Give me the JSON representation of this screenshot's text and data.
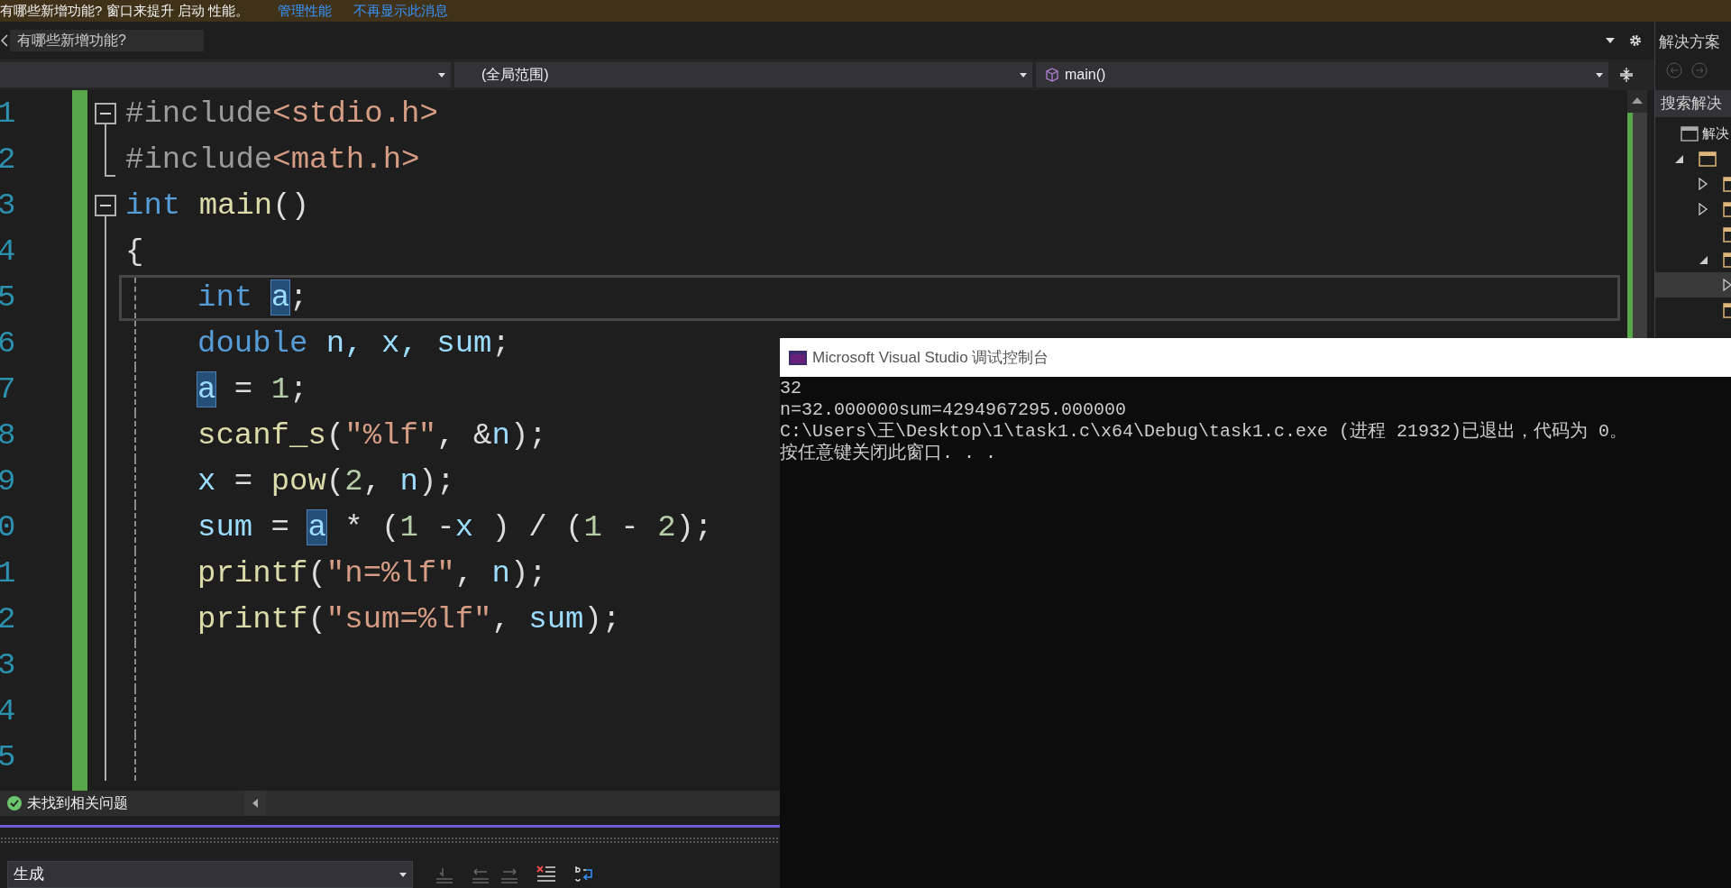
{
  "banner": {
    "message": "有哪些新增功能? 窗口来提升 启动 性能。",
    "links": [
      "管理性能",
      "不再显示此消息"
    ]
  },
  "tabs": [
    {
      "label": "有哪些新增功能?",
      "selected": true
    }
  ],
  "navigation": {
    "scope": "(全局范围)",
    "member": "main()"
  },
  "editor": {
    "lines": [
      {
        "number": "1",
        "kind": "fold_start",
        "in_body": false,
        "current": false,
        "tokens": [
          {
            "kind": "directive",
            "text": "#include"
          },
          {
            "kind": "header",
            "text": "<stdio.h>"
          }
        ]
      },
      {
        "number": "2",
        "kind": "fold_end",
        "in_body": false,
        "current": false,
        "tokens": [
          {
            "kind": "directive",
            "text": "#include"
          },
          {
            "kind": "header",
            "text": "<math.h>"
          }
        ]
      },
      {
        "number": "3",
        "kind": "fold_start",
        "in_body": false,
        "current": false,
        "tokens": [
          {
            "kind": "keyword",
            "text": "int "
          },
          {
            "kind": "func",
            "text": "main"
          },
          {
            "kind": "punct",
            "text": "()"
          }
        ]
      },
      {
        "number": "4",
        "kind": "block",
        "in_body": false,
        "current": false,
        "tokens": [
          {
            "kind": "punct",
            "text": "{"
          }
        ]
      },
      {
        "number": "5",
        "kind": "block",
        "in_body": true,
        "current": true,
        "tokens": [
          {
            "kind": "keyword",
            "text": "int "
          },
          {
            "kind": "ref",
            "text": "a"
          },
          {
            "kind": "punct",
            "text": ";"
          }
        ]
      },
      {
        "number": "6",
        "kind": "block",
        "in_body": true,
        "current": false,
        "tokens": [
          {
            "kind": "keyword",
            "text": "double"
          },
          {
            "kind": "var",
            "text": " n, x, sum"
          },
          {
            "kind": "punct",
            "text": ";"
          }
        ]
      },
      {
        "number": "7",
        "kind": "block",
        "in_body": true,
        "current": false,
        "tokens": [
          {
            "kind": "ref",
            "text": "a"
          },
          {
            "kind": "punct",
            "text": " = "
          },
          {
            "kind": "number",
            "text": "1"
          },
          {
            "kind": "punct",
            "text": ";"
          }
        ]
      },
      {
        "number": "8",
        "kind": "block",
        "in_body": true,
        "current": false,
        "tokens": [
          {
            "kind": "func",
            "text": "scanf_s"
          },
          {
            "kind": "punct",
            "text": "("
          },
          {
            "kind": "string",
            "text": "\"%lf\""
          },
          {
            "kind": "punct",
            "text": ", &"
          },
          {
            "kind": "var",
            "text": "n"
          },
          {
            "kind": "punct",
            "text": ");"
          }
        ]
      },
      {
        "number": "9",
        "kind": "block",
        "in_body": true,
        "current": false,
        "tokens": [
          {
            "kind": "var",
            "text": "x"
          },
          {
            "kind": "punct",
            "text": " = "
          },
          {
            "kind": "func",
            "text": "pow"
          },
          {
            "kind": "punct",
            "text": "("
          },
          {
            "kind": "number",
            "text": "2"
          },
          {
            "kind": "punct",
            "text": ", "
          },
          {
            "kind": "var",
            "text": "n"
          },
          {
            "kind": "punct",
            "text": ");"
          }
        ]
      },
      {
        "number": "0",
        "kind": "block",
        "in_body": true,
        "current": false,
        "tokens": [
          {
            "kind": "var",
            "text": "sum"
          },
          {
            "kind": "punct",
            "text": " = "
          },
          {
            "kind": "ref",
            "text": "a"
          },
          {
            "kind": "punct",
            "text": " * ("
          },
          {
            "kind": "number",
            "text": "1"
          },
          {
            "kind": "punct",
            "text": " -"
          },
          {
            "kind": "var",
            "text": "x"
          },
          {
            "kind": "punct",
            "text": " ) / ("
          },
          {
            "kind": "number",
            "text": "1"
          },
          {
            "kind": "punct",
            "text": " - "
          },
          {
            "kind": "number",
            "text": "2"
          },
          {
            "kind": "punct",
            "text": ");"
          }
        ]
      },
      {
        "number": "1",
        "kind": "block",
        "in_body": true,
        "current": false,
        "tokens": [
          {
            "kind": "func",
            "text": "printf"
          },
          {
            "kind": "punct",
            "text": "("
          },
          {
            "kind": "string",
            "text": "\"n=%lf\""
          },
          {
            "kind": "punct",
            "text": ", "
          },
          {
            "kind": "var",
            "text": "n"
          },
          {
            "kind": "punct",
            "text": ");"
          }
        ]
      },
      {
        "number": "2",
        "kind": "block",
        "in_body": true,
        "current": false,
        "tokens": [
          {
            "kind": "func",
            "text": "printf"
          },
          {
            "kind": "punct",
            "text": "("
          },
          {
            "kind": "string",
            "text": "\"sum=%lf\""
          },
          {
            "kind": "punct",
            "text": ", "
          },
          {
            "kind": "var",
            "text": "sum"
          },
          {
            "kind": "punct",
            "text": ");"
          }
        ]
      },
      {
        "number": "3",
        "kind": "block",
        "in_body": true,
        "current": false
      },
      {
        "number": "4",
        "kind": "block",
        "in_body": true,
        "current": false
      },
      {
        "number": "5",
        "kind": "block",
        "in_body": true,
        "current": false
      }
    ]
  },
  "status": {
    "message": "未找到相关问题"
  },
  "output": {
    "source": "生成"
  },
  "console": {
    "title": "Microsoft Visual Studio 调试控制台",
    "lines": [
      "32",
      "n=32.000000sum=4294967295.000000",
      "C:\\Users\\王\\Desktop\\1\\task1.c\\x64\\Debug\\task1.c.exe (进程 21932)已退出，代码为 0。",
      "按任意键关闭此窗口. . ."
    ]
  },
  "solution_explorer": {
    "title": "解决方案",
    "search": {
      "placeholder": "搜索解决"
    },
    "tree": [
      {
        "label": "解决",
        "selected": false,
        "children": [
          {
            "expanded": true,
            "selected": false,
            "children": [
              {
                "expanded": false,
                "selected": false
              },
              {
                "expanded": false,
                "selected": false
              },
              {
                "selected": false
              },
              {
                "expanded": true,
                "selected": false,
                "children": [
                  {
                    "expanded": false,
                    "selected": true
                  }
                ]
              },
              {
                "selected": false
              }
            ]
          }
        ]
      }
    ]
  }
}
